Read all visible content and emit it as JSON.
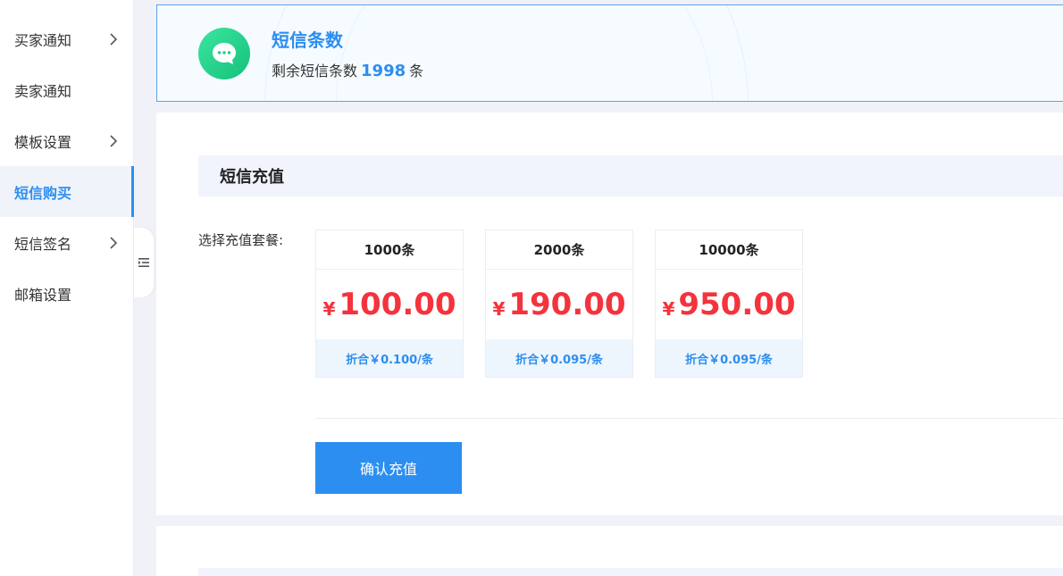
{
  "sidebar": {
    "items": [
      {
        "label": "买家通知",
        "has_chevron": true,
        "active": false
      },
      {
        "label": "卖家通知",
        "has_chevron": false,
        "active": false
      },
      {
        "label": "模板设置",
        "has_chevron": true,
        "active": false
      },
      {
        "label": "短信购买",
        "has_chevron": false,
        "active": true
      },
      {
        "label": "短信签名",
        "has_chevron": true,
        "active": false
      },
      {
        "label": "邮箱设置",
        "has_chevron": false,
        "active": false
      }
    ]
  },
  "sms_summary": {
    "title": "短信条数",
    "remain_prefix": "剩余短信条数",
    "remain_count": "1998",
    "remain_suffix": "条",
    "icon": "chat-bubble-icon"
  },
  "recharge": {
    "header": "短信充值",
    "package_label": "选择充值套餐:",
    "packages": [
      {
        "name": "1000条",
        "currency": "¥",
        "price": "100.00",
        "unit_price": "折合￥0.100/条"
      },
      {
        "name": "2000条",
        "currency": "¥",
        "price": "190.00",
        "unit_price": "折合￥0.095/条"
      },
      {
        "name": "10000条",
        "currency": "¥",
        "price": "950.00",
        "unit_price": "折合￥0.095/条"
      }
    ],
    "confirm_label": "确认充值"
  },
  "colors": {
    "accent": "#2c8ef0",
    "price": "#f4333c",
    "icon_green": "#1fcf88"
  }
}
